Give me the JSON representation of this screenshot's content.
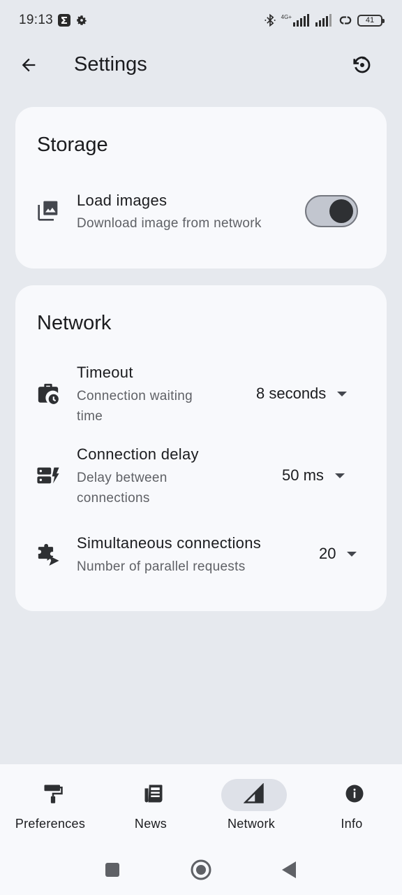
{
  "status_bar": {
    "time": "19:13",
    "network_label": "4G+",
    "battery": "41",
    "icons": [
      "sigma-icon",
      "gear-icon",
      "bluetooth-icon",
      "signal-icon",
      "signal-icon",
      "link-icon",
      "battery-icon"
    ]
  },
  "app_bar": {
    "title": "Settings",
    "back_icon": "arrow-left-icon",
    "reset_icon": "restore-icon"
  },
  "storage": {
    "title": "Storage",
    "load_images": {
      "title": "Load images",
      "subtitle": "Download image from network",
      "enabled": true,
      "icon": "image-stack-icon"
    }
  },
  "network": {
    "title": "Network",
    "timeout": {
      "title": "Timeout",
      "subtitle_line1": "Connection waiting",
      "subtitle_line2": "time",
      "value": "8 seconds",
      "icon": "briefcase-clock-icon"
    },
    "connection_delay": {
      "title": "Connection delay",
      "subtitle_line1": "Delay between",
      "subtitle_line2": "connections",
      "value": "50 ms",
      "icon": "server-bolt-icon"
    },
    "simultaneous": {
      "title": "Simultaneous connections",
      "subtitle": "Number of parallel requests",
      "value": "20",
      "icon": "puzzle-send-icon"
    }
  },
  "bottom_nav": {
    "items": [
      {
        "label": "Preferences",
        "icon": "paint-roller-icon",
        "active": false
      },
      {
        "label": "News",
        "icon": "newspaper-icon",
        "active": false
      },
      {
        "label": "Network",
        "icon": "signal-triangle-icon",
        "active": true
      },
      {
        "label": "Info",
        "icon": "info-icon",
        "active": false
      }
    ]
  },
  "colors": {
    "background": "#e6e9ee",
    "card": "#f8f9fc",
    "switch_track": "#c2c6cf",
    "switch_thumb": "#2e3033",
    "active_pill": "#dee1e8"
  }
}
